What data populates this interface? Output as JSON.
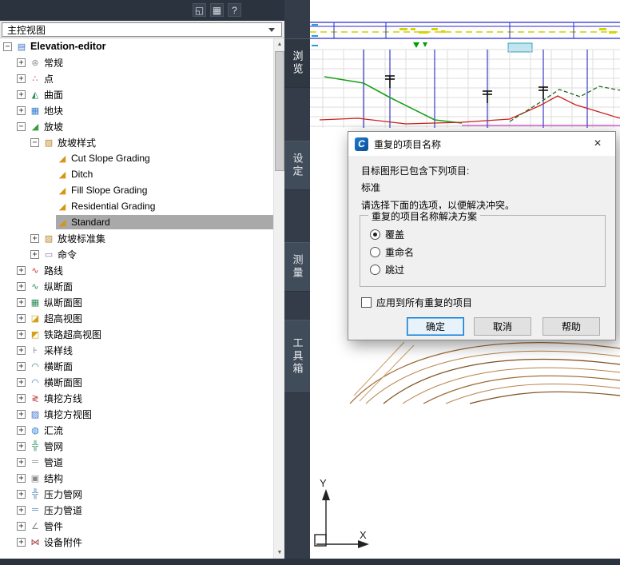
{
  "toolspace": {
    "view_selector": "主控视图",
    "tabs": [
      {
        "id": "prospector",
        "label": "浏览",
        "active": true
      },
      {
        "id": "settings",
        "label": "设定",
        "active": false
      },
      {
        "id": "survey",
        "label": "测量",
        "active": false
      },
      {
        "id": "toolbox",
        "label": "工具箱",
        "active": false
      }
    ],
    "tree": {
      "items": [
        {
          "id": "elevation-editor",
          "label": "Elevation-editor",
          "indent": 0,
          "toggle": "minus",
          "icon": "drawing-icon",
          "bold": true
        },
        {
          "id": "general",
          "label": "常规",
          "indent": 1,
          "toggle": "plus",
          "icon": "general-icon"
        },
        {
          "id": "points",
          "label": "点",
          "indent": 1,
          "toggle": "plus",
          "icon": "points-icon"
        },
        {
          "id": "surfaces",
          "label": "曲面",
          "indent": 1,
          "toggle": "plus",
          "icon": "surface-icon"
        },
        {
          "id": "parcels",
          "label": "地块",
          "indent": 1,
          "toggle": "plus",
          "icon": "parcel-icon"
        },
        {
          "id": "grading",
          "label": "放坡",
          "indent": 1,
          "toggle": "minus",
          "icon": "grading-icon"
        },
        {
          "id": "grading-styles",
          "label": "放坡样式",
          "indent": 2,
          "toggle": "minus",
          "icon": "style-collection-icon"
        },
        {
          "id": "cut-slope-grading",
          "label": "Cut Slope Grading",
          "indent": 3,
          "icon": "slope-style-icon"
        },
        {
          "id": "ditch",
          "label": "Ditch",
          "indent": 3,
          "icon": "slope-style-icon"
        },
        {
          "id": "fill-slope-grading",
          "label": "Fill Slope Grading",
          "indent": 3,
          "icon": "slope-style-icon"
        },
        {
          "id": "residential-grading",
          "label": "Residential Grading",
          "indent": 3,
          "icon": "slope-style-icon"
        },
        {
          "id": "standard",
          "label": "Standard",
          "indent": 3,
          "icon": "slope-style-icon",
          "selected": true
        },
        {
          "id": "grading-criteria-sets",
          "label": "放坡标准集",
          "indent": 2,
          "toggle": "plus",
          "icon": "criteria-set-icon"
        },
        {
          "id": "commands",
          "label": "命令",
          "indent": 2,
          "toggle": "plus",
          "icon": "commands-icon"
        },
        {
          "id": "alignments",
          "label": "路线",
          "indent": 1,
          "toggle": "plus",
          "icon": "alignment-icon"
        },
        {
          "id": "profiles",
          "label": "纵断面",
          "indent": 1,
          "toggle": "plus",
          "icon": "profile-icon"
        },
        {
          "id": "profile-views",
          "label": "纵断面图",
          "indent": 1,
          "toggle": "plus",
          "icon": "profile-view-icon"
        },
        {
          "id": "superelevation-views",
          "label": "超高视图",
          "indent": 1,
          "toggle": "plus",
          "icon": "superelevation-view-icon"
        },
        {
          "id": "rail-superelevation-views",
          "label": "铁路超高视图",
          "indent": 1,
          "toggle": "plus",
          "icon": "rail-superelevation-view-icon"
        },
        {
          "id": "sample-lines",
          "label": "采样线",
          "indent": 1,
          "toggle": "plus",
          "icon": "sample-lines-icon"
        },
        {
          "id": "sections",
          "label": "横断面",
          "indent": 1,
          "toggle": "plus",
          "icon": "section-icon"
        },
        {
          "id": "section-views",
          "label": "横断面图",
          "indent": 1,
          "toggle": "plus",
          "icon": "section-view-icon"
        },
        {
          "id": "quantity-lines",
          "label": "填挖方线",
          "indent": 1,
          "toggle": "plus",
          "icon": "quantity-lines-icon"
        },
        {
          "id": "quantity-views",
          "label": "填挖方视图",
          "indent": 1,
          "toggle": "plus",
          "icon": "quantity-view-icon"
        },
        {
          "id": "catchments",
          "label": "汇流",
          "indent": 1,
          "toggle": "plus",
          "icon": "catchment-icon"
        },
        {
          "id": "pipe-networks",
          "label": "管网",
          "indent": 1,
          "toggle": "plus",
          "icon": "pipe-network-icon"
        },
        {
          "id": "pipes",
          "label": "管道",
          "indent": 1,
          "toggle": "plus",
          "icon": "pipe-icon"
        },
        {
          "id": "structures",
          "label": "结构",
          "indent": 1,
          "toggle": "plus",
          "icon": "structure-icon"
        },
        {
          "id": "pressure-networks",
          "label": "压力管网",
          "indent": 1,
          "toggle": "plus",
          "icon": "pressure-network-icon"
        },
        {
          "id": "pressure-pipes",
          "label": "压力管道",
          "indent": 1,
          "toggle": "plus",
          "icon": "pressure-pipe-icon"
        },
        {
          "id": "fittings",
          "label": "管件",
          "indent": 1,
          "toggle": "plus",
          "icon": "fitting-icon"
        },
        {
          "id": "appurtenances",
          "label": "设备附件",
          "indent": 1,
          "toggle": "plus",
          "icon": "appurtenance-icon"
        }
      ]
    }
  },
  "dialog": {
    "title": "重复的项目名称",
    "message_intro": "目标图形已包含下列项目:",
    "duplicate_item": "标准",
    "message_instruction": "请选择下面的选项，以便解决冲突。",
    "group_title": "重复的项目名称解决方案",
    "options": [
      {
        "id": "overwrite",
        "label": "覆盖",
        "selected": true
      },
      {
        "id": "rename",
        "label": "重命名",
        "selected": false
      },
      {
        "id": "skip",
        "label": "跳过",
        "selected": false
      }
    ],
    "apply_all": {
      "label": "应用到所有重复的项目",
      "checked": false
    },
    "buttons": {
      "ok": "确定",
      "cancel": "取消",
      "help": "帮助"
    }
  },
  "drawing": {
    "ucs": {
      "x_label": "X",
      "y_label": "Y"
    }
  }
}
